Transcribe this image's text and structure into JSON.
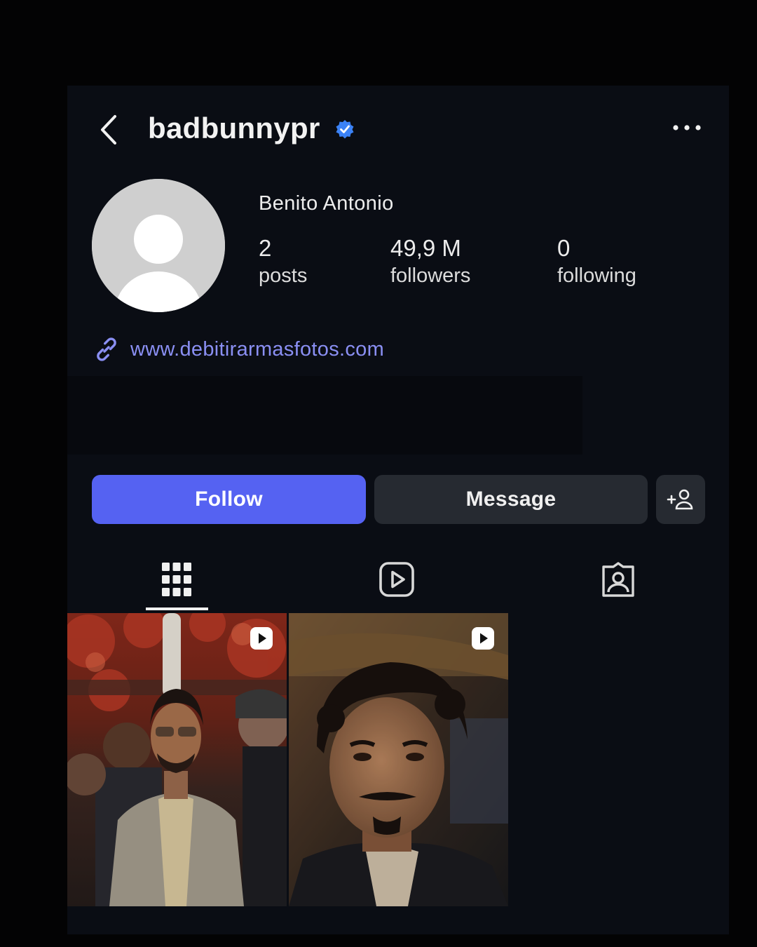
{
  "header": {
    "username": "badbunnypr",
    "verified": true
  },
  "profile": {
    "display_name": "Benito Antonio",
    "stats": [
      {
        "value": "2",
        "label": "posts"
      },
      {
        "value": "49,9 M",
        "label": "followers"
      },
      {
        "value": "0",
        "label": "following"
      }
    ],
    "link": "www.debitirarmasfotos.com"
  },
  "actions": {
    "follow_label": "Follow",
    "message_label": "Message"
  },
  "tabs": [
    {
      "icon": "grid-icon",
      "selected": true
    },
    {
      "icon": "reels-icon",
      "selected": false
    },
    {
      "icon": "tagged-icon",
      "selected": false
    }
  ],
  "posts": [
    {
      "type": "reel",
      "icon": "reel-icon"
    },
    {
      "type": "reel",
      "icon": "reel-icon"
    }
  ],
  "colors": {
    "background": "#0a0d14",
    "accent": "#5562f2",
    "link": "#8a8ff3",
    "verified": "#3b82f6",
    "secondary_button": "#262a31"
  }
}
